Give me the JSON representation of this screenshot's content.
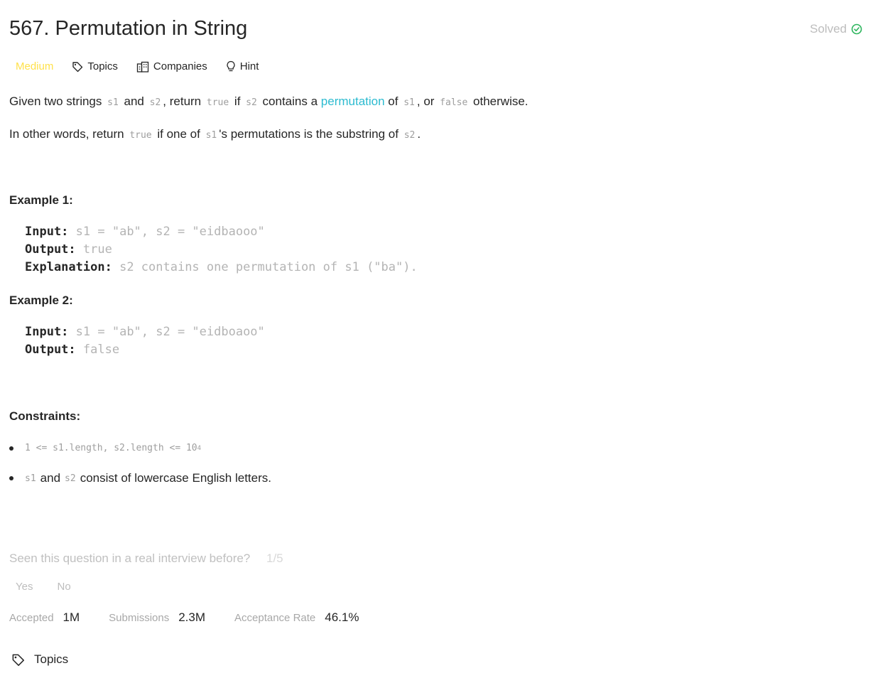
{
  "title": "567. Permutation in String",
  "status": {
    "label": "Solved",
    "icon": "check-circle-icon",
    "color": "#2db55d"
  },
  "meta": {
    "difficulty": "Medium",
    "topics_label": "Topics",
    "companies_label": "Companies",
    "hint_label": "Hint"
  },
  "description": {
    "p1": {
      "t1": "Given two strings",
      "c1": "s1",
      "t2": "and",
      "c2": "s2",
      "t3": ", return",
      "c3": "true",
      "t4": "if",
      "c4": "s2",
      "t5": "contains a",
      "link": "permutation",
      "t6": "of",
      "c5": "s1",
      "t7": ", or",
      "c6": "false",
      "t8": "otherwise."
    },
    "p2": {
      "t1": "In other words, return",
      "c1": "true",
      "t2": "if one of",
      "c2": "s1",
      "t3": "'s permutations is the substring of",
      "c3": "s2",
      "t4": "."
    }
  },
  "examples": [
    {
      "heading": "Example 1:",
      "input_label": "Input:",
      "input": "s1 = \"ab\", s2 = \"eidbaooo\"",
      "output_label": "Output:",
      "output": "true",
      "explanation_label": "Explanation:",
      "explanation": "s2 contains one permutation of s1 (\"ba\")."
    },
    {
      "heading": "Example 2:",
      "input_label": "Input:",
      "input": "s1 = \"ab\", s2 = \"eidboaoo\"",
      "output_label": "Output:",
      "output": "false"
    }
  ],
  "constraints": {
    "heading": "Constraints:",
    "c1_code": "1 <= s1.length, s2.length <= 10",
    "c1_sup": "4",
    "c2_code_a": "s1",
    "c2_text_a": "and",
    "c2_code_b": "s2",
    "c2_text_b": "consist of lowercase English letters."
  },
  "interview": {
    "question": "Seen this question in a real interview before?",
    "count": "1/5",
    "yes": "Yes",
    "no": "No"
  },
  "stats": {
    "accepted_label": "Accepted",
    "accepted_value": "1M",
    "submissions_label": "Submissions",
    "submissions_value": "2.3M",
    "rate_label": "Acceptance Rate",
    "rate_value": "46.1%"
  },
  "footer": {
    "topics_label": "Topics",
    "icon": "tag-icon"
  }
}
